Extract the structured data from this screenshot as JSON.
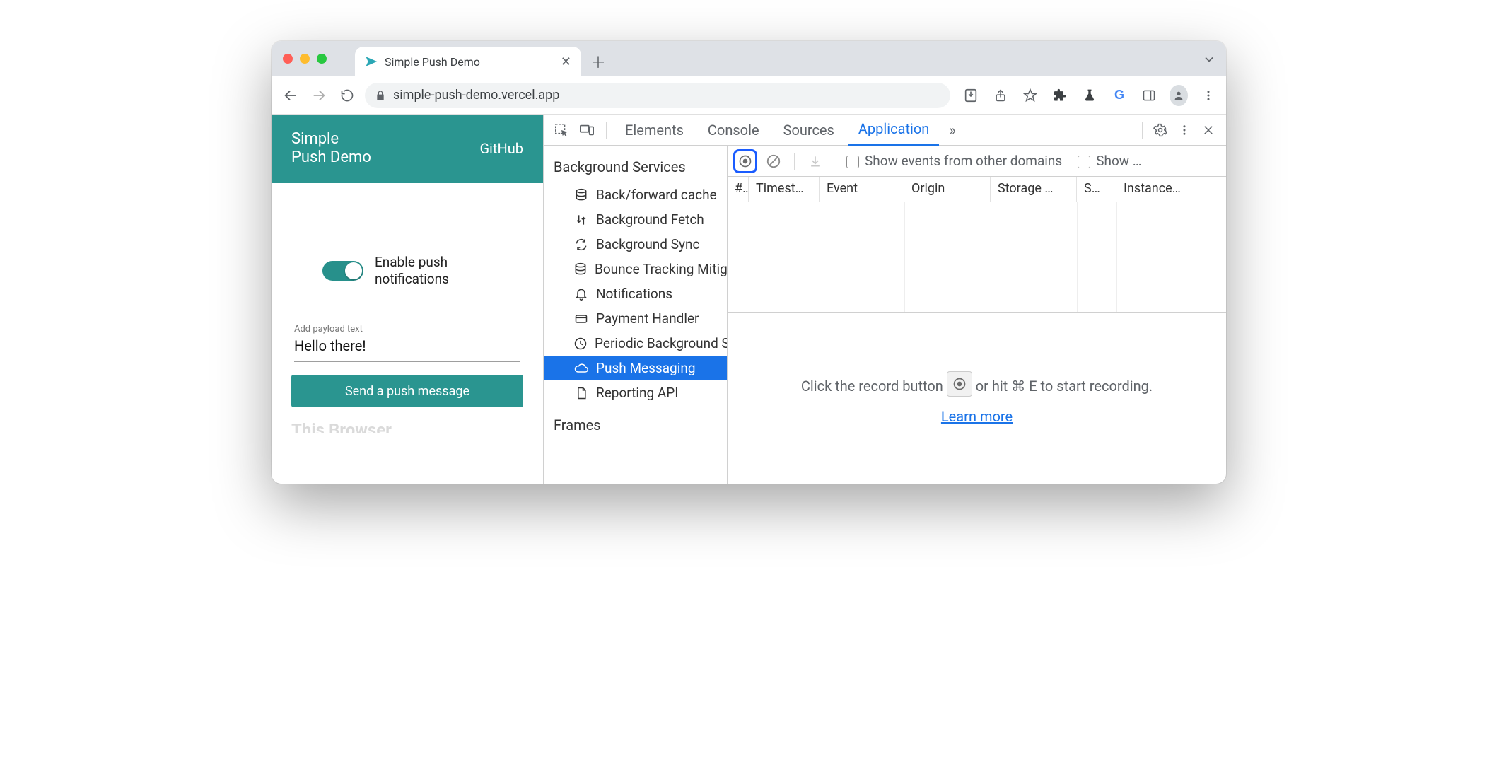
{
  "window": {
    "tab_title": "Simple Push Demo",
    "url": "simple-push-demo.vercel.app"
  },
  "page": {
    "app_title_line1": "Simple",
    "app_title_line2": "Push Demo",
    "github_link": "GitHub",
    "toggle_label_line1": "Enable push",
    "toggle_label_line2": "notifications",
    "payload": {
      "label": "Add payload text",
      "value": "Hello there!"
    },
    "send_button": "Send a push message",
    "cutoff_heading": "This Browser"
  },
  "devtools": {
    "tabs": {
      "elements": "Elements",
      "console": "Console",
      "sources": "Sources",
      "application": "Application",
      "more": "»"
    },
    "sidebar": {
      "section": "Background Services",
      "items": [
        "Back/forward cache",
        "Background Fetch",
        "Background Sync",
        "Bounce Tracking Mitigations",
        "Notifications",
        "Payment Handler",
        "Periodic Background Sync",
        "Push Messaging",
        "Reporting API"
      ],
      "frames": "Frames"
    },
    "toolbar": {
      "show_other_domains": "Show events from other domains",
      "show_truncated": "Show …"
    },
    "table": {
      "columns": [
        "#",
        "Timest…",
        "Event",
        "Origin",
        "Storage …",
        "S…",
        "Instance…"
      ]
    },
    "empty_state": {
      "prefix": "Click the record button ",
      "suffix": " or hit ⌘ E to start recording.",
      "learn_more": "Learn more"
    }
  },
  "colors": {
    "teal": "#2a9590",
    "blue": "#1a73e8",
    "highlight": "#1a5cff"
  }
}
